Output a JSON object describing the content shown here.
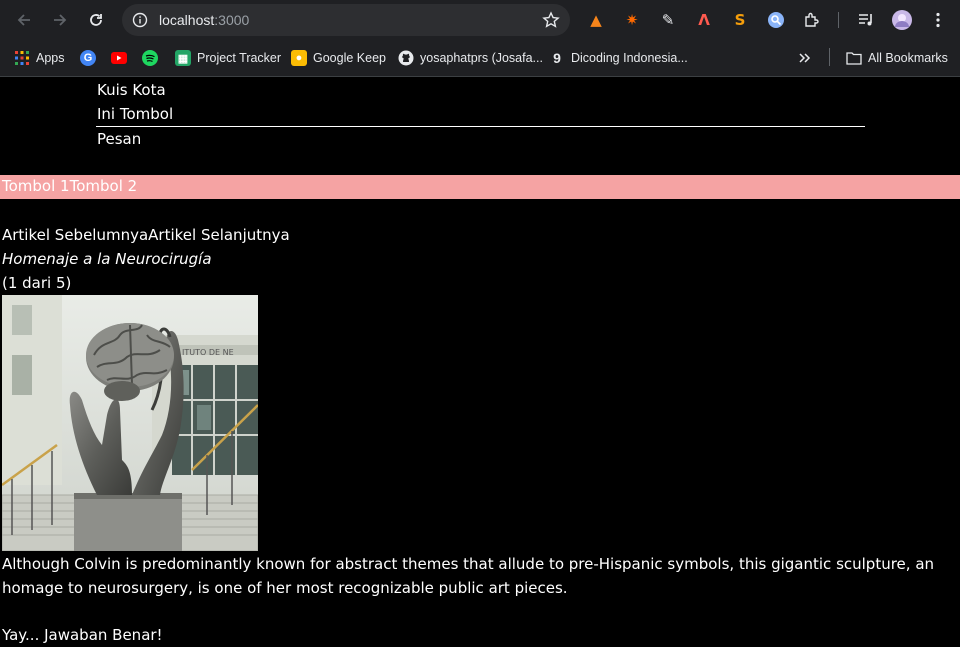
{
  "browser": {
    "url_host": "localhost",
    "url_port": ":3000"
  },
  "bookmarks": [
    {
      "label": "Apps",
      "icon": "apps-grid-icon"
    },
    {
      "label": "",
      "icon": "google-account-icon"
    },
    {
      "label": "",
      "icon": "youtube-icon"
    },
    {
      "label": "",
      "icon": "spotify-icon"
    },
    {
      "label": "Project Tracker",
      "icon": "sheets-icon"
    },
    {
      "label": "Google Keep",
      "icon": "keep-icon"
    },
    {
      "label": "yosaphatprs (Josafa...",
      "icon": "github-icon"
    },
    {
      "label": "Dicoding Indonesia...",
      "icon": "dicoding-icon"
    },
    {
      "label": "All Bookmarks",
      "icon": "folder-icon"
    }
  ],
  "menu": {
    "item1": "Kuis Kota",
    "item2": "Ini Tombol",
    "item3": "Pesan"
  },
  "buttons": {
    "btn1": "Tombol 1",
    "btn2": "Tombol 2"
  },
  "article_nav": {
    "prev": "Artikel Sebelumnya",
    "next": "Artikel Selanjutnya"
  },
  "artwork": {
    "title": "Homenaje a la Neurocirugía",
    "counter": "(1 dari 5)",
    "description": "Although Colvin is predominantly known for abstract themes that allude to pre-Hispanic symbols, this gigantic sculpture, an homage to neurosurgery, is one of her most recognizable public art pieces.",
    "building_sign": "ITUTO DE NE"
  },
  "result": "Yay... Jawaban Benar!",
  "colors": {
    "pink_bar": "#f5a3a3",
    "chrome_bg": "#1f2023"
  }
}
